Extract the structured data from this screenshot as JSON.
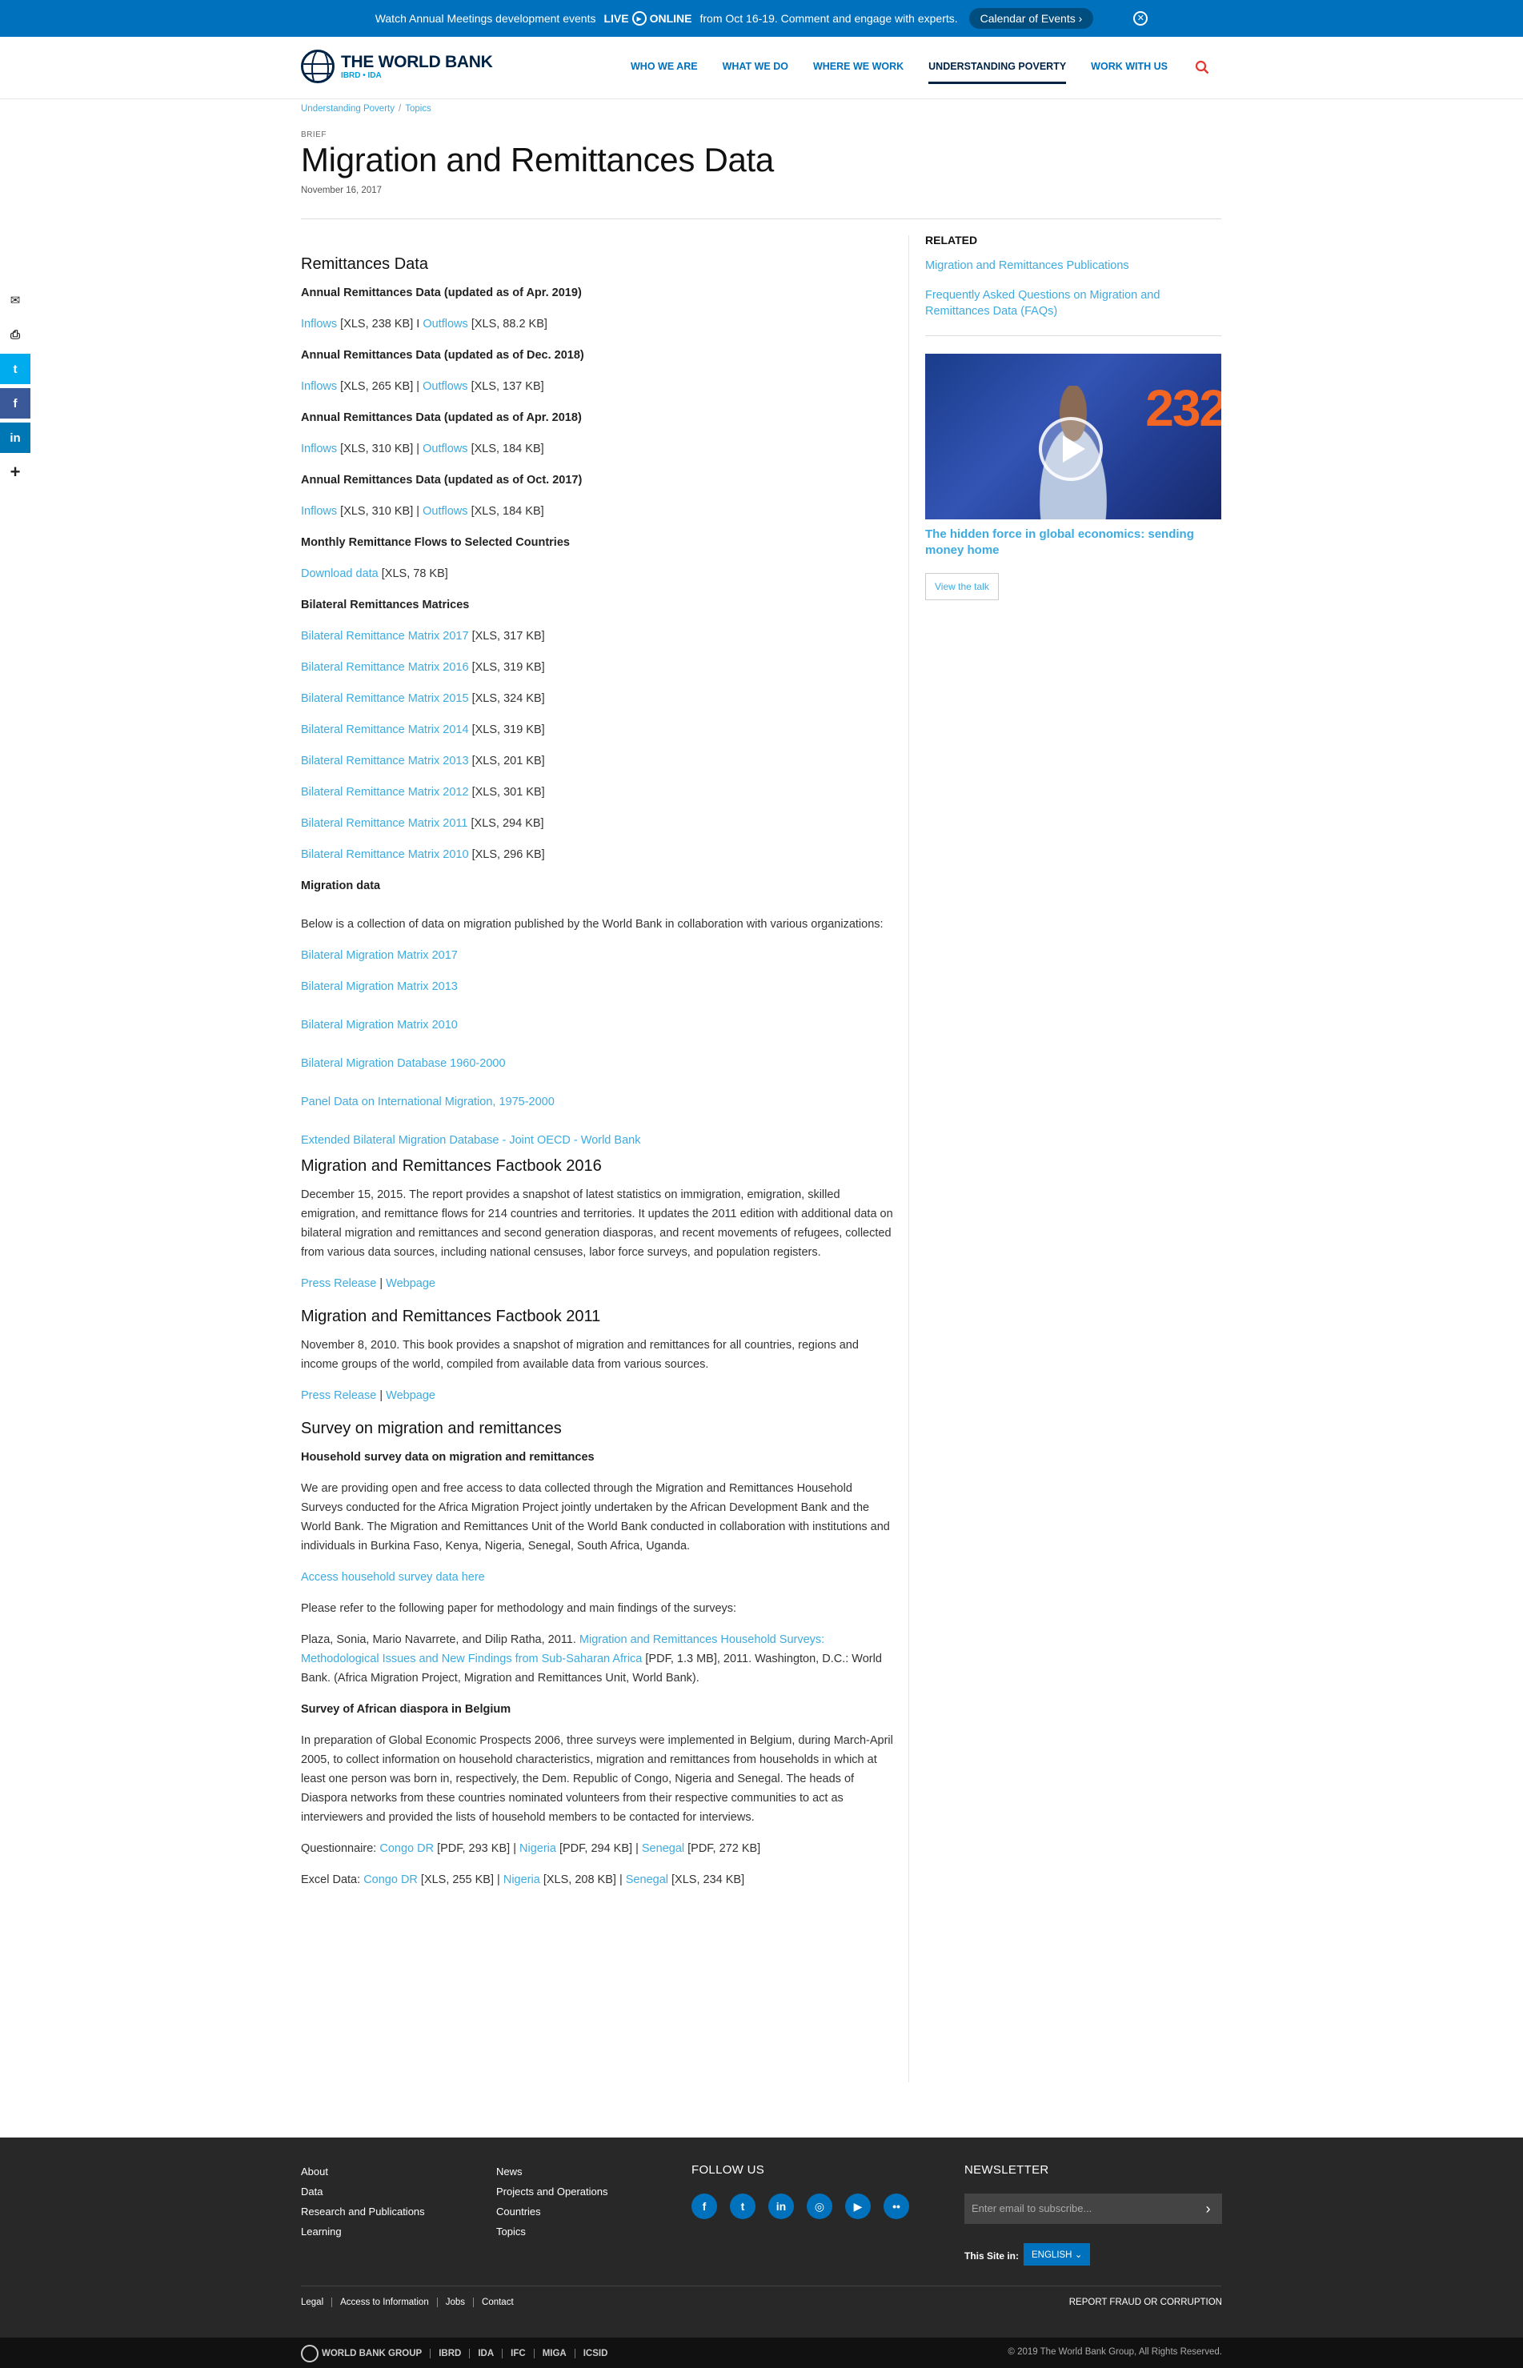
{
  "banner": {
    "text_before": "Watch Annual Meetings development events",
    "live_prefix": "LIVE",
    "live_suffix": "ONLINE",
    "text_after": "from Oct 16-19. Comment and engage with experts.",
    "calendar_button": "Calendar of Events",
    "close_icon": "close-icon"
  },
  "header": {
    "logo_name": "THE WORLD BANK",
    "logo_sub": "IBRD • IDA",
    "nav": [
      "WHO WE ARE",
      "WHAT WE DO",
      "WHERE WE WORK",
      "UNDERSTANDING POVERTY",
      "WORK WITH US"
    ],
    "active_nav": "UNDERSTANDING POVERTY",
    "search_icon": "search-icon"
  },
  "breadcrumb": [
    "Understanding Poverty",
    "Topics"
  ],
  "page": {
    "type_label": "BRIEF",
    "title": "Migration and Remittances Data",
    "date": "November 16, 2017"
  },
  "share": [
    "email-icon",
    "print-icon",
    "twitter-icon",
    "facebook-icon",
    "linkedin-icon",
    "plus-icon"
  ],
  "content": {
    "remit_heading": "Remittances Data",
    "annual": [
      {
        "heading": "Annual Remittances Data (updated as of Apr. 2019)",
        "in_label": "Inflows",
        "in_size": "[XLS, 238 KB]",
        "sep": "I",
        "out_label": "Outflows",
        "out_size": "[XLS, 88.2 KB]"
      },
      {
        "heading": "Annual Remittances Data (updated as of Dec. 2018)",
        "in_label": "Inflows",
        "in_size": "[XLS, 265 KB]",
        "sep": "|",
        "out_label": "Outflows",
        "out_size": "[XLS, 137 KB]"
      },
      {
        "heading": "Annual Remittances Data (updated as of Apr. 2018)",
        "in_label": "Inflows",
        "in_size": "[XLS, 310 KB]",
        "sep": "|",
        "out_label": "Outflows",
        "out_size": "[XLS, 184 KB]"
      },
      {
        "heading": "Annual Remittances Data (updated as of Oct. 2017)",
        "in_label": "Inflows",
        "in_size": "[XLS, 310 KB]",
        "sep": "|",
        "out_label": "Outflows",
        "out_size": "[XLS, 184 KB]"
      }
    ],
    "monthly_heading": "Monthly Remittance Flows to Selected Countries",
    "monthly_link": "Download data",
    "monthly_size": "[XLS, 78 KB]",
    "bilateral_heading": "Bilateral Remittances Matrices",
    "matrices": [
      {
        "label": "Bilateral Remittance Matrix 2017",
        "size": "[XLS, 317 KB]"
      },
      {
        "label": "Bilateral Remittance Matrix 2016",
        "size": "[XLS, 319 KB]"
      },
      {
        "label": "Bilateral Remittance Matrix 2015",
        "size": "[XLS, 324 KB]"
      },
      {
        "label": "Bilateral Remittance Matrix 2014",
        "size": "[XLS, 319 KB]"
      },
      {
        "label": "Bilateral Remittance Matrix 2013",
        "size": "[XLS, 201 KB]"
      },
      {
        "label": "Bilateral Remittance Matrix 2012",
        "size": "[XLS, 301 KB]"
      },
      {
        "label": "Bilateral Remittance Matrix 2011",
        "size": "[XLS, 294 KB]"
      },
      {
        "label": "Bilateral Remittance Matrix 2010",
        "size": "[XLS, 296 KB]"
      }
    ],
    "migration_heading": "Migration data",
    "migration_intro": "Below is a collection of data on migration published by the World Bank in  collaboration with various organizations:",
    "migration_links": [
      "Bilateral Migration Matrix 2017",
      "Bilateral Migration Matrix 2013",
      "Bilateral Migration Matrix 2010",
      "Bilateral Migration Database 1960-2000",
      "Panel Data on International Migration, 1975-2000",
      "Extended Bilateral Migration Database - Joint OECD - World Bank"
    ],
    "factbook2016": {
      "heading": "Migration and Remittances Factbook 2016",
      "text": "December 15, 2015. The report provides a snapshot of latest statistics on immigration, emigration, skilled emigration, and remittance flows for 214 countries and territories. It updates the 2011 edition with additional data on bilateral migration and remittances and second generation diasporas, and recent movements of refugees, collected from various data sources, including national censuses, labor force surveys, and population registers.",
      "press": "Press Release",
      "sep": "|",
      "web": "Webpage"
    },
    "factbook2011": {
      "heading": "Migration and Remittances Factbook 2011",
      "text": "November 8, 2010. This book provides a snapshot of migration and remittances for all countries, regions and income groups of the world, compiled from available data from various sources.",
      "press": "Press Release",
      "sep": "|",
      "web": "Webpage"
    },
    "survey": {
      "heading": "Survey on migration and remittances",
      "sub1": "Household survey data on migration and remittances",
      "text1": "We are providing open and free access to data collected through the Migration and Remittances Household Surveys conducted for the Africa Migration Project jointly undertaken by the African Development Bank and the World Bank. The Migration and Remittances Unit of the World Bank conducted in collaboration with institutions and individuals in Burkina Faso, Kenya, Nigeria, Senegal, South Africa, Uganda.",
      "access_link": "Access household survey data here",
      "refer": "Please refer to the following paper for methodology and main findings of the surveys:",
      "cite_before": "Plaza, Sonia, Mario Navarrete, and Dilip Ratha, 2011.",
      "cite_link": "Migration and Remittances Household Surveys: Methodological Issues and New Findings from Sub-Saharan Africa",
      "cite_after": "[PDF, 1.3 MB], 2011. Washington, D.C.: World Bank. (Africa Migration Project, Migration and Remittances Unit, World Bank).",
      "sub2": "Survey of African diaspora in Belgium",
      "text2": "In preparation of Global Economic Prospects 2006, three surveys were implemented in Belgium, during March-April 2005, to collect information on household characteristics, migration and remittances from households in which at least one person was born in, respectively, the Dem. Republic of Congo, Nigeria and Senegal. The heads of Diaspora networks from these countries nominated volunteers from their respective communities to act as interviewers and provided the lists of household members to be contacted for interviews.",
      "q_label": "Questionnaire:",
      "q_links": [
        {
          "label": "Congo DR",
          "size": "[PDF, 293 KB]"
        },
        {
          "label": "Nigeria",
          "size": "[PDF, 294 KB]"
        },
        {
          "label": "Senegal",
          "size": "[PDF, 272 KB]"
        }
      ],
      "x_label": "Excel Data:",
      "x_links": [
        {
          "label": "Congo DR",
          "size": "[XLS, 255 KB]"
        },
        {
          "label": "Nigeria",
          "size": "[XLS, 208 KB]"
        },
        {
          "label": "Senegal",
          "size": "[XLS, 234 KB]"
        }
      ],
      "sep": "|"
    }
  },
  "sidebar": {
    "related_heading": "RELATED",
    "related_links": [
      "Migration and Remittances Publications",
      "Frequently Asked Questions on Migration and Remittances Data (FAQs)"
    ],
    "video_overlay_text": "232",
    "video_title": "The hidden force in global economics: sending money home",
    "video_button": "View the talk"
  },
  "footer": {
    "col1": [
      "About",
      "Data",
      "Research and Publications",
      "Learning"
    ],
    "col2": [
      "News",
      "Projects and Operations",
      "Countries",
      "Topics"
    ],
    "follow_heading": "FOLLOW US",
    "social": [
      {
        "icon": "facebook-icon",
        "glyph": "f"
      },
      {
        "icon": "twitter-icon",
        "glyph": "t"
      },
      {
        "icon": "linkedin-icon",
        "glyph": "in"
      },
      {
        "icon": "instagram-icon",
        "glyph": "◎"
      },
      {
        "icon": "youtube-icon",
        "glyph": "▶"
      },
      {
        "icon": "flickr-icon",
        "glyph": "••"
      }
    ],
    "newsletter_heading": "NEWSLETTER",
    "newsletter_placeholder": "Enter email to subscribe...",
    "site_in_label": "This Site in:",
    "language": "ENGLISH",
    "legal": [
      "Legal",
      "Access to Information",
      "Jobs",
      "Contact"
    ],
    "report": "REPORT FRAUD OR CORRUPTION",
    "group": [
      "WORLD BANK GROUP",
      "IBRD",
      "IDA",
      "IFC",
      "MIGA",
      "ICSID"
    ],
    "copyright": "© 2019 The World Bank Group, All Rights Reserved."
  },
  "colors": {
    "banner": "#0071bc",
    "link": "#3dabe0",
    "footer": "#282828",
    "brand_navy": "#002244"
  }
}
